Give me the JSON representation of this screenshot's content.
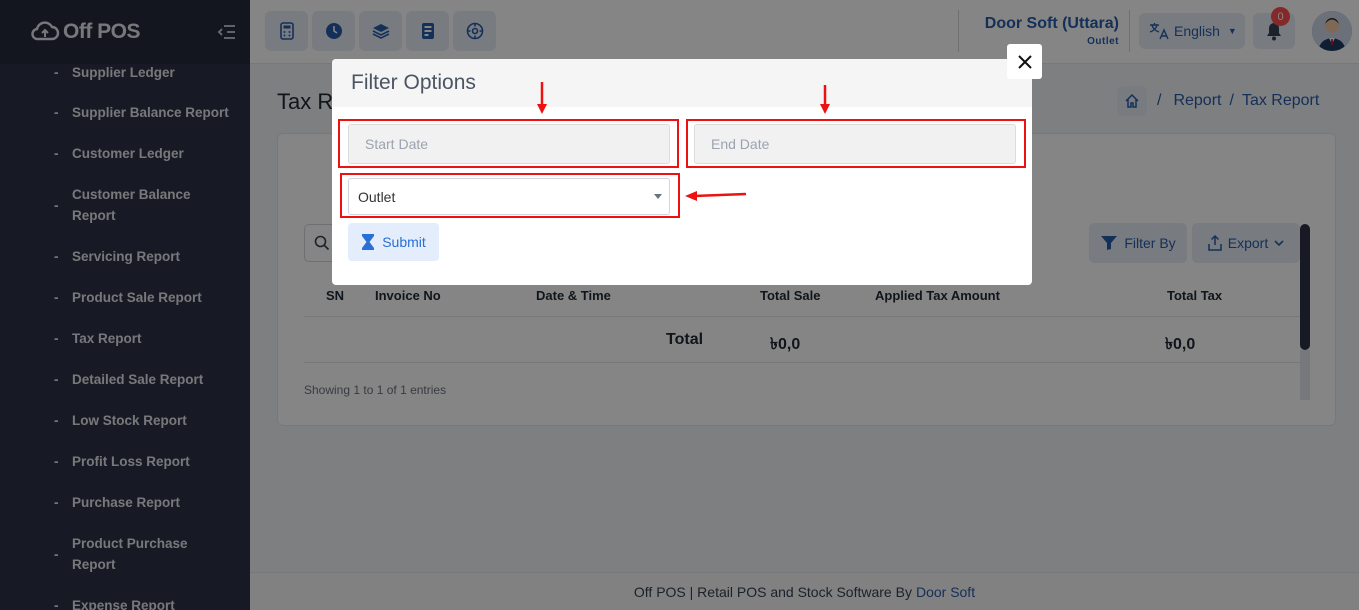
{
  "app": {
    "logo_text": "Off POS"
  },
  "sidebar": {
    "items": [
      {
        "label": "Supplier Ledger"
      },
      {
        "label": "Supplier Balance Report"
      },
      {
        "label": "Customer Ledger"
      },
      {
        "label": "Customer Balance Report"
      },
      {
        "label": "Servicing Report"
      },
      {
        "label": "Product Sale Report"
      },
      {
        "label": "Tax Report"
      },
      {
        "label": "Detailed Sale Report"
      },
      {
        "label": "Low Stock Report"
      },
      {
        "label": "Profit Loss Report"
      },
      {
        "label": "Purchase Report"
      },
      {
        "label": "Product Purchase Report"
      },
      {
        "label": "Expense Report"
      }
    ],
    "dash": "-"
  },
  "header": {
    "outlet_name": "Door Soft (Uttara)",
    "outlet_label": "Outlet",
    "language": "English",
    "notification_count": "0"
  },
  "page": {
    "title": "Tax Report",
    "breadcrumb": [
      "Report",
      "Tax Report"
    ],
    "breadcrumb_sep": "/",
    "filter_button": "Filter By",
    "export_button": "Export",
    "table": {
      "columns": [
        "SN",
        "Invoice No",
        "Date & Time",
        "Total Sale",
        "Applied Tax Amount",
        "Total Tax"
      ],
      "total_label": "Total",
      "total_sale": "৳0,0",
      "total_tax": "৳0,0"
    },
    "entries_info": "Showing 1 to 1 of 1 entries"
  },
  "modal": {
    "title": "Filter Options",
    "start_date_placeholder": "Start Date",
    "end_date_placeholder": "End Date",
    "outlet_selected": "Outlet",
    "submit_label": "Submit"
  },
  "footer": {
    "text": "Off POS | Retail POS and Stock Software By",
    "link": "Door Soft"
  },
  "colors": {
    "sidebar_bg": "#2d3346",
    "accent": "#2a5caa",
    "annotation_red": "#e11"
  }
}
